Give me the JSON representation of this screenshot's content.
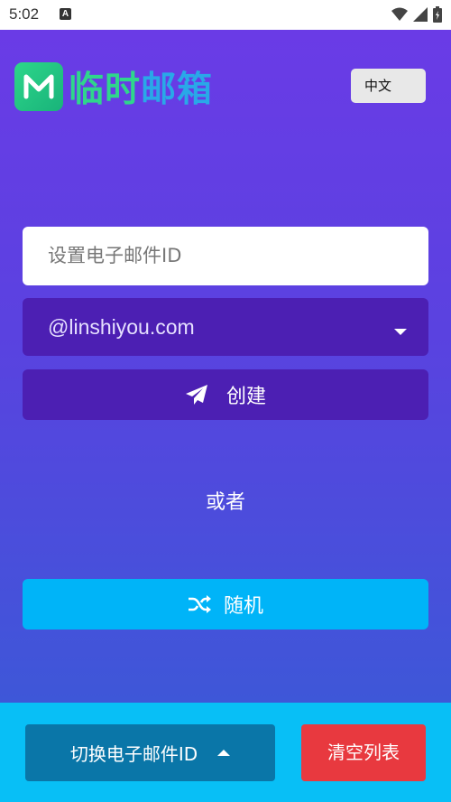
{
  "status_bar": {
    "time": "5:02",
    "notification_badge": "A"
  },
  "header": {
    "logo_letter": "M",
    "logo_title_part1": "临时",
    "logo_title_part2": "邮箱",
    "language_button": "中文"
  },
  "form": {
    "email_placeholder": "设置电子邮件ID",
    "domain_selected": "@linshiyou.com",
    "create_label": "创建",
    "or_label": "或者",
    "random_label": "随机"
  },
  "bottom_bar": {
    "switch_label": "切换电子邮件ID",
    "clear_label": "清空列表"
  },
  "colors": {
    "gradient_top": "#6a3be6",
    "gradient_bottom": "#3e57d8",
    "dark_purple": "#4c1fb3",
    "cyan": "#00b4f8",
    "red": "#e8393f",
    "logo_green": "#2fd68c",
    "logo_blue": "#29a8e8"
  },
  "icons": {
    "create": "paper-plane-icon",
    "random": "shuffle-icon",
    "domain_dropdown": "caret-down-icon",
    "switch": "caret-up-icon"
  }
}
